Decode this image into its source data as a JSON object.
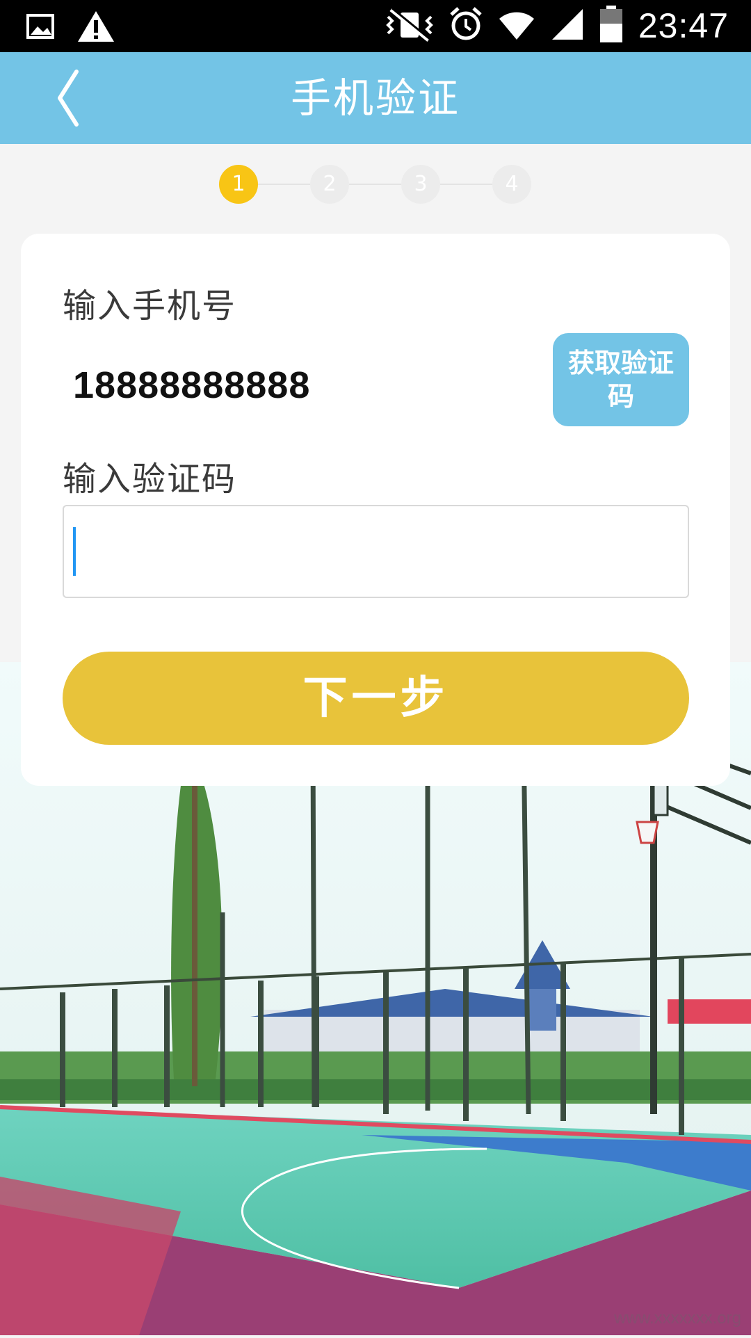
{
  "status_bar": {
    "time": "23:47",
    "icons": [
      "gallery-icon",
      "warning-icon",
      "vibrate-icon",
      "alarm-icon",
      "wifi-icon",
      "signal-icon",
      "battery-icon"
    ]
  },
  "app_bar": {
    "title": "手机验证",
    "back_icon": "chevron-left-icon"
  },
  "steps": {
    "items": [
      "1",
      "2",
      "3",
      "4"
    ],
    "current": 1
  },
  "form": {
    "phone_label": "输入手机号",
    "phone_value": "18888888888",
    "get_code_label": "获取验证码",
    "code_label": "输入验证码",
    "code_value": "",
    "next_label": "下一步"
  },
  "watermark": "www.xxxxxxx.org",
  "colors": {
    "primary": "#73c4e6",
    "accent": "#e8c33a",
    "step_active": "#f8c515",
    "step_inactive": "#ececec",
    "background": "#f4f4f4"
  }
}
